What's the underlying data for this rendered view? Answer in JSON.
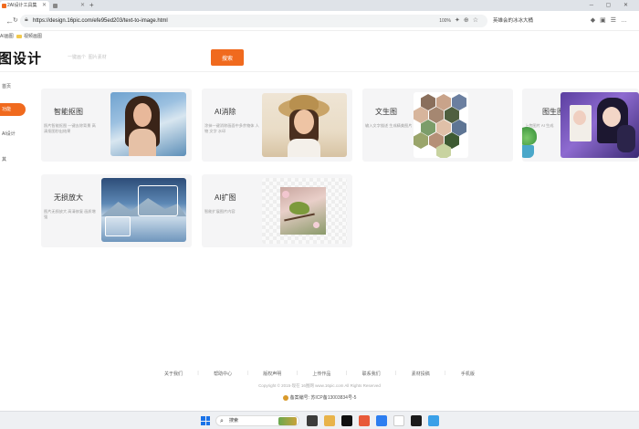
{
  "browser": {
    "tabs": [
      {
        "label": "2AI设计工具集",
        "active": true
      },
      {
        "label": "",
        "active": false
      }
    ],
    "url": "https://design.16pic.com/efe95ed203/text-to-image.html",
    "zoom": "100%",
    "toolbar_text": "英雄会的冰冰大桶",
    "bookmarks": [
      "AI画图",
      "视频画图"
    ]
  },
  "header": {
    "site_title": "图设计",
    "search_placeholder": "一键画个  图片素材",
    "search_button": "搜索"
  },
  "sidebar": {
    "items": [
      {
        "label": "首页",
        "active": false
      },
      {
        "label": "功能",
        "active": true
      },
      {
        "label": "AI设计",
        "active": false
      },
      {
        "label": "其",
        "active": false
      }
    ]
  },
  "cards": [
    {
      "title": "智能抠图",
      "desc": "照片智能抠图 一键去除背景 高清抠图秒出结果",
      "image": "portrait-woman"
    },
    {
      "title": "AI消除",
      "desc": "涂抹一键消除画面中多余物体 人物 文字 水印",
      "image": "woman-straw-hat"
    },
    {
      "title": "文生图",
      "desc": "输入文字描述 生成精美图片",
      "image": "hex-collage"
    },
    {
      "title": "图生图",
      "desc": "上传图片 AI 生成",
      "image": "anime-couple"
    },
    {
      "title": "无损放大",
      "desc": "图片无损放大 高清修复 画质增强",
      "image": "mountain-lake"
    },
    {
      "title": "AI扩图",
      "desc": "智能扩展图片内容",
      "image": "bird-branch"
    }
  ],
  "footer": {
    "links": [
      "关于我们",
      "帮助中心",
      "版权声明",
      "上传作品",
      "联系我们",
      "素材投稿",
      "手机版"
    ],
    "copyright": "Copyright © 2015-现在 16图网 www.16pic.com All Rights Reserved",
    "icp": "备案编号: 苏ICP备13003834号-5"
  },
  "taskbar": {
    "search_label": "搜索"
  },
  "colors": {
    "accent": "#f06a1e",
    "card_bg": "#f5f5f6"
  }
}
